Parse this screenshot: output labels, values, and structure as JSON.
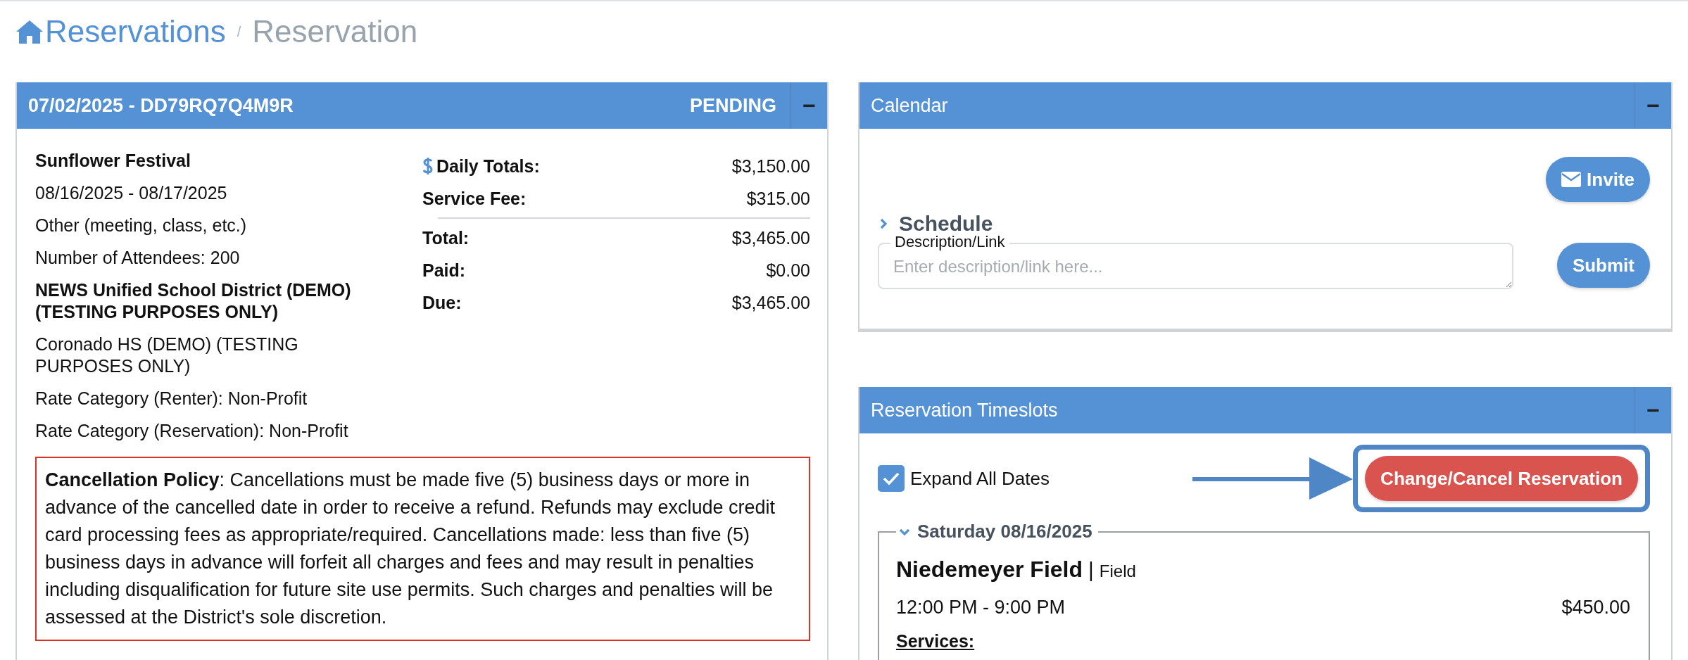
{
  "breadcrumb": {
    "parent": "Reservations",
    "current": "Reservation",
    "separator": "/"
  },
  "reservation": {
    "title": "07/02/2025 - DD79RQ7Q4M9R",
    "status": "PENDING",
    "collapse": "−",
    "details": [
      {
        "text": "Sunflower Festival",
        "bold": true
      },
      {
        "text": "08/16/2025 - 08/17/2025",
        "bold": false
      },
      {
        "text": "Other (meeting, class, etc.)",
        "bold": false
      },
      {
        "text": "Number of Attendees: 200",
        "bold": false
      },
      {
        "text": "NEWS Unified School District (DEMO) (TESTING PURPOSES ONLY)",
        "bold": true
      },
      {
        "text": "Coronado HS (DEMO) (TESTING PURPOSES ONLY)",
        "bold": false
      },
      {
        "text": "Rate Category (Renter): Non-Profit",
        "bold": false
      },
      {
        "text": "Rate Category (Reservation): Non-Profit",
        "bold": false
      }
    ],
    "charges": [
      {
        "label": "Daily Totals:",
        "value": "$3,150.00",
        "icon": true
      },
      {
        "label": "Service Fee:",
        "value": "$315.00",
        "icon": false
      }
    ],
    "summary": [
      {
        "label": "Total:",
        "value": "$3,465.00",
        "icon": false
      },
      {
        "label": "Paid:",
        "value": "$0.00",
        "icon": false
      },
      {
        "label": "Due:",
        "value": "$3,465.00",
        "icon": false
      }
    ],
    "policy": "**Cancellation Policy**: Cancellations must be made five (5) business days or more in advance of the cancelled date in order to receive a refund. Refunds may exclude credit card processing fees as appropriate/required. Cancellations made: less than five (5) business days in advance will forfeit all charges and fees and may result in penalties including disqualification for future site use permits. Such charges and penalties will be assessed at the District's sole discretion."
  },
  "calendar": {
    "title": "Calendar",
    "collapse": "−",
    "invite": "Invite",
    "schedule": "Schedule",
    "schedule_expanded": false,
    "field_label": "Description/Link",
    "placeholder": "Enter description/link here...",
    "submit": "Submit"
  },
  "timeslots": {
    "title": "Reservation Timeslots",
    "collapse": "−",
    "expand_all": {
      "label": "Expand All Dates",
      "checked": true
    },
    "change_button": "Change/Cancel Reservation",
    "days": [
      {
        "date": "Saturday 08/16/2025",
        "expanded": true,
        "facility": "Niedemeyer Field",
        "separator": "|",
        "type": "Field",
        "time": "12:00 PM - 9:00 PM",
        "price": "$450.00",
        "services_label": "Services:"
      }
    ]
  }
}
